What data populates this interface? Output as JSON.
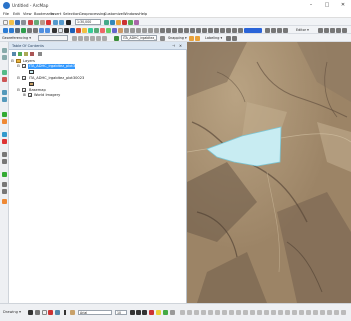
{
  "window": {
    "title": "Untitled - ArcMap",
    "minimize_glyph": "–",
    "maximize_glyph": "□",
    "close_glyph": "✕"
  },
  "menu": [
    "File",
    "Edit",
    "View",
    "Bookmarks",
    "Insert",
    "Selection",
    "Geoprocessing",
    "Customize",
    "Windows",
    "Help"
  ],
  "toolbar": {
    "scale_value": "1:30,000",
    "editor_label": "Editor ▾",
    "georeferencing_label": "Georeferencing ▾",
    "layer_combo": "ITA_ADHC_irgabitez_plot30 ▾",
    "snapping_label": "Snapping ▾",
    "labeling_label": "Labeling ▾"
  },
  "toc": {
    "title": "Table Of Contents",
    "close_glyph": "✕",
    "pin_glyph": "⊣",
    "layers_label": "Layers",
    "layer1_name": "ITA_ADHC_irgabitez_plot30",
    "layer2_name": "ITA_ADHC_irgabitez_plot30023",
    "basemap_group": "Basemap",
    "world_imagery": "World Imagery"
  },
  "statusbar": {
    "drawing_label": "Drawing ▾",
    "font_label": "Arial",
    "font_size": "10"
  },
  "colors": {
    "selection_highlight": "#3399ff",
    "polygon_fill": "#c8ecf2",
    "polygon_stroke": "#7ac7d6",
    "layer2_swatch": "#c9a26a",
    "map_base": "#a89275"
  }
}
